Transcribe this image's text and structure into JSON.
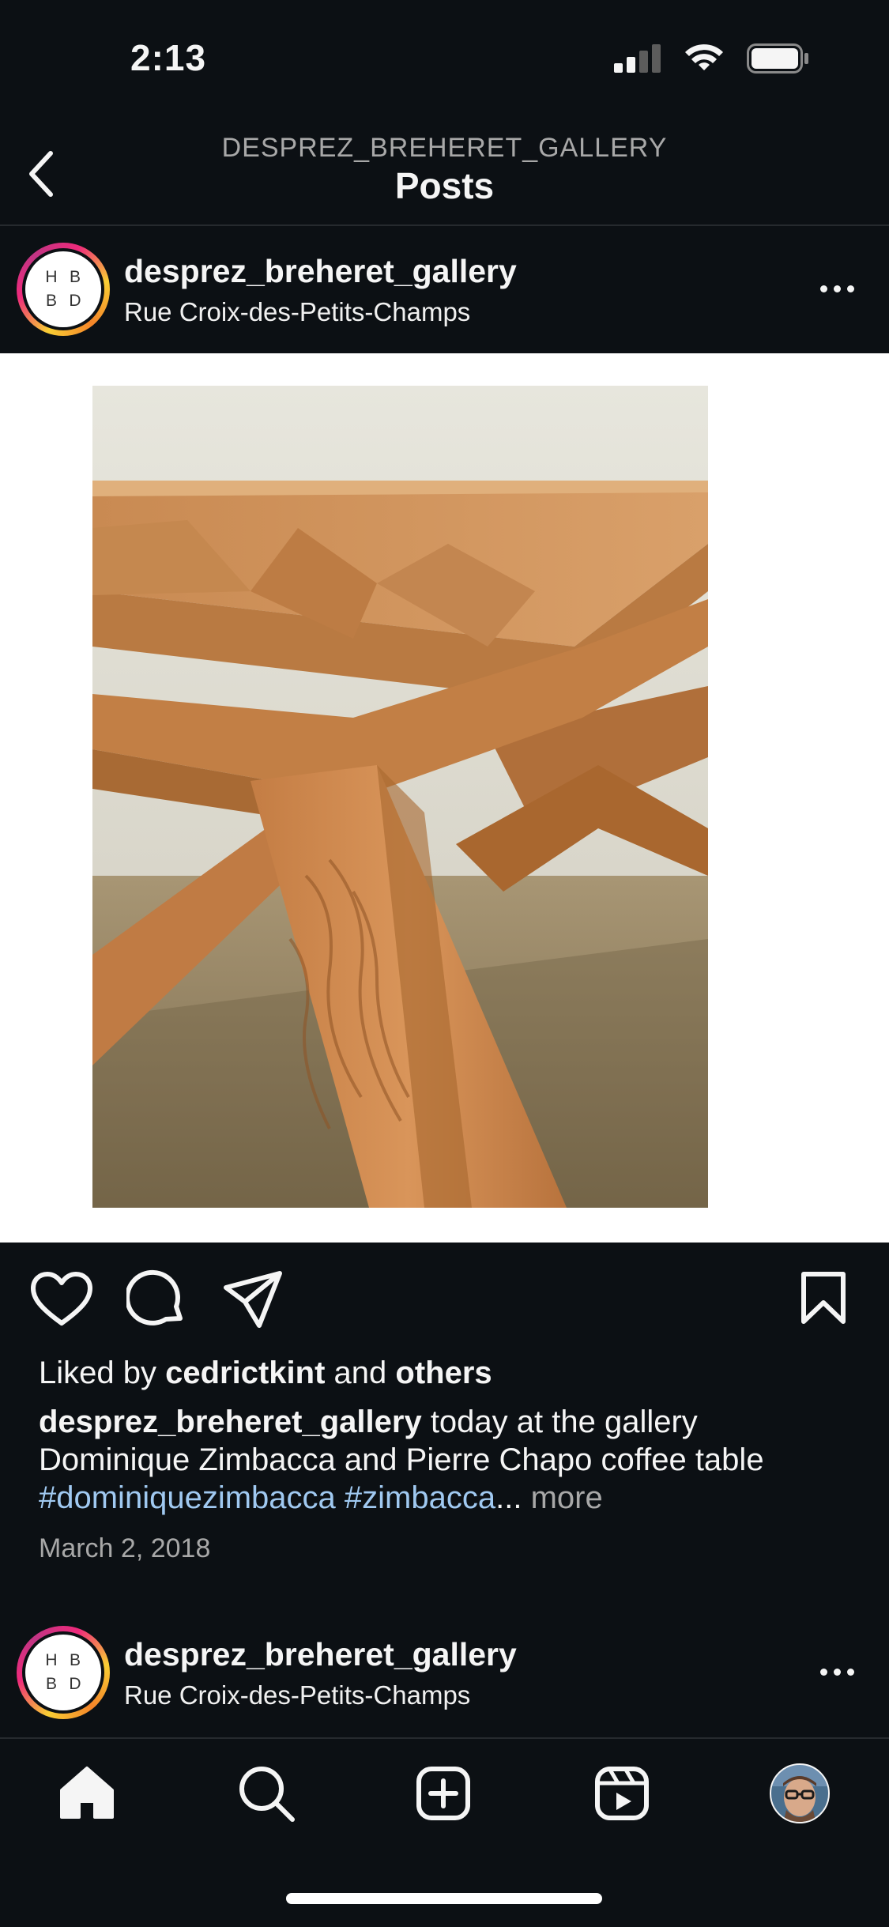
{
  "status_bar": {
    "time": "2:13"
  },
  "header": {
    "subtitle": "DESPREZ_BREHERET_GALLERY",
    "title": "Posts"
  },
  "post": {
    "avatar_letters": [
      "H",
      "B",
      "B",
      "D"
    ],
    "username": "desprez_breheret_gallery",
    "location": "Rue Croix-des-Petits-Champs",
    "likes": {
      "prefix": "Liked by",
      "user": "cedrictkint",
      "middle": "and",
      "others": "others"
    },
    "caption": {
      "username": "desprez_breheret_gallery",
      "line1": "today at the gallery",
      "line2": "Dominique Zimbacca and Pierre Chapo coffee table",
      "tag1": "#dominiquezimbacca",
      "tag2": "#zimbacca",
      "ellipsis": "...",
      "more": "more"
    },
    "date": "March 2, 2018"
  },
  "next_post": {
    "avatar_letters": [
      "H",
      "B",
      "B",
      "D"
    ],
    "username": "desprez_breheret_gallery",
    "location": "Rue Croix-des-Petits-Champs"
  },
  "icons": {
    "back": "chevron-left-icon",
    "like": "heart-icon",
    "comment": "comment-icon",
    "share": "paper-plane-icon",
    "save": "bookmark-icon",
    "home": "home-icon",
    "search": "search-icon",
    "create": "plus-square-icon",
    "reels": "reels-icon",
    "profile": "profile-avatar"
  },
  "colors": {
    "background": "#0c1014",
    "text": "#f5f5f5",
    "muted": "#a8a8a8",
    "hashtag": "#a0c9f1",
    "media_bg": "#ffffff"
  }
}
